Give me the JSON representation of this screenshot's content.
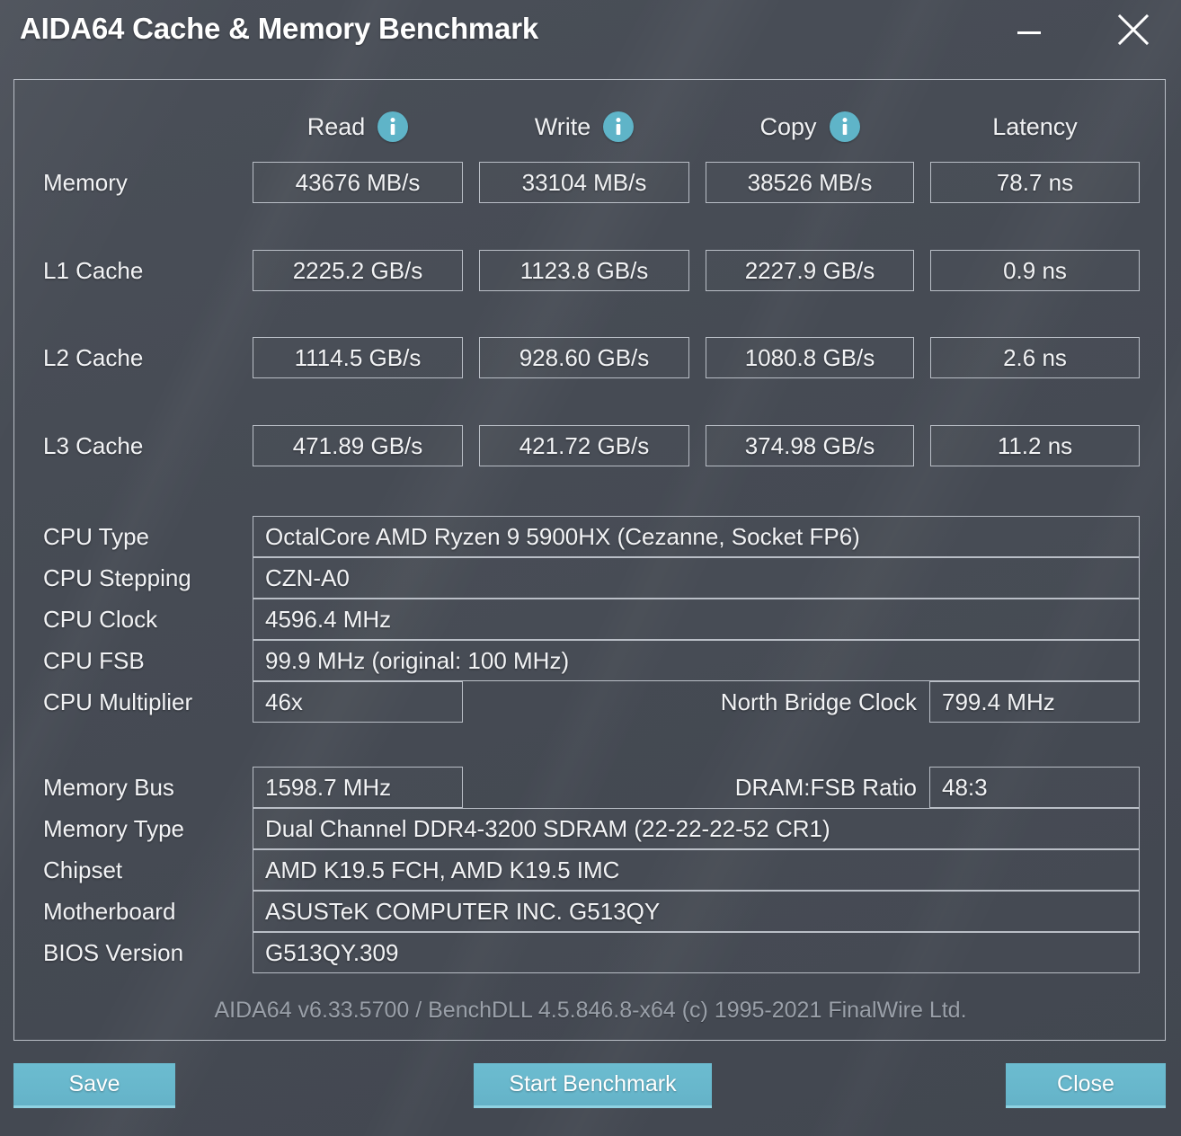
{
  "window": {
    "title": "AIDA64 Cache & Memory Benchmark",
    "minimize_label": "Minimize",
    "close_label": "Close window",
    "minimize_icon": "minimize-icon",
    "close_icon": "close-icon"
  },
  "benchmark": {
    "columns": [
      {
        "label": "Read",
        "icon": "info-icon"
      },
      {
        "label": "Write",
        "icon": "info-icon"
      },
      {
        "label": "Copy",
        "icon": "info-icon"
      },
      {
        "label": "Latency",
        "icon": null
      }
    ],
    "rows": [
      {
        "label": "Memory",
        "read": "43676 MB/s",
        "write": "33104 MB/s",
        "copy": "38526 MB/s",
        "latency": "78.7 ns"
      },
      {
        "label": "L1 Cache",
        "read": "2225.2 GB/s",
        "write": "1123.8 GB/s",
        "copy": "2227.9 GB/s",
        "latency": "0.9 ns"
      },
      {
        "label": "L2 Cache",
        "read": "1114.5 GB/s",
        "write": "928.60 GB/s",
        "copy": "1080.8 GB/s",
        "latency": "2.6 ns"
      },
      {
        "label": "L3 Cache",
        "read": "471.89 GB/s",
        "write": "421.72 GB/s",
        "copy": "374.98 GB/s",
        "latency": "11.2 ns"
      }
    ]
  },
  "cpu_info": {
    "cpu_type_label": "CPU Type",
    "cpu_type_value": "OctalCore AMD Ryzen 9 5900HX  (Cezanne, Socket FP6)",
    "cpu_stepping_label": "CPU Stepping",
    "cpu_stepping_value": "CZN-A0",
    "cpu_clock_label": "CPU Clock",
    "cpu_clock_value": "4596.4 MHz",
    "cpu_fsb_label": "CPU FSB",
    "cpu_fsb_value": "99.9 MHz  (original: 100 MHz)",
    "cpu_multiplier_label": "CPU Multiplier",
    "cpu_multiplier_value": "46x",
    "north_bridge_label": "North Bridge Clock",
    "north_bridge_value": "799.4 MHz"
  },
  "system_info": {
    "memory_bus_label": "Memory Bus",
    "memory_bus_value": "1598.7 MHz",
    "dram_fsb_label": "DRAM:FSB Ratio",
    "dram_fsb_value": "48:3",
    "memory_type_label": "Memory Type",
    "memory_type_value": "Dual Channel DDR4-3200 SDRAM  (22-22-22-52 CR1)",
    "chipset_label": "Chipset",
    "chipset_value": "AMD K19.5 FCH, AMD K19.5 IMC",
    "motherboard_label": "Motherboard",
    "motherboard_value": "ASUSTeK COMPUTER INC. G513QY",
    "bios_label": "BIOS Version",
    "bios_value": "G513QY.309"
  },
  "credit": "AIDA64 v6.33.5700 / BenchDLL 4.5.846.8-x64  (c) 1995-2021 FinalWire Ltd.",
  "buttons": {
    "save": "Save",
    "start": "Start Benchmark",
    "close": "Close"
  },
  "colors": {
    "accent": "#64b2c7",
    "info_icon": "#5fb4c8",
    "window_bg": "#474c55",
    "border": "#b9bec6",
    "text": "#f2f3f5",
    "credit_text": "#9aa0a9"
  }
}
